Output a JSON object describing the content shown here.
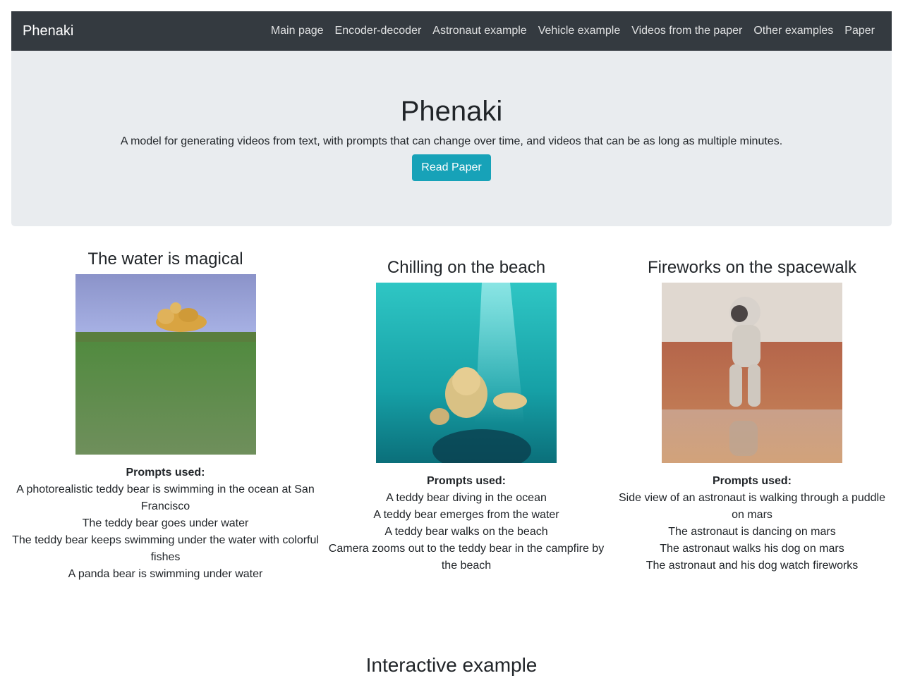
{
  "navbar": {
    "brand": "Phenaki",
    "links": [
      "Main page",
      "Encoder-decoder",
      "Astronaut example",
      "Vehicle example",
      "Videos from the paper",
      "Other examples",
      "Paper"
    ]
  },
  "hero": {
    "title": "Phenaki",
    "subtitle": "A model for generating videos from text, with prompts that can change over time, and videos that can be as long as multiple minutes.",
    "button": "Read Paper"
  },
  "examples": [
    {
      "title": "The water is magical",
      "prompts_label": "Prompts used:",
      "prompts": [
        "A photorealistic teddy bear is swimming in the ocean at San Francisco",
        "The teddy bear goes under water",
        "The teddy bear keeps swimming under the water with colorful fishes",
        "A panda bear is swimming under water"
      ]
    },
    {
      "title": "Chilling on the beach",
      "prompts_label": "Prompts used:",
      "prompts": [
        "A teddy bear diving in the ocean",
        "A teddy bear emerges from the water",
        "A teddy bear walks on the beach",
        "Camera zooms out to the teddy bear in the campfire by the beach"
      ]
    },
    {
      "title": "Fireworks on the spacewalk",
      "prompts_label": "Prompts used:",
      "prompts": [
        "Side view of an astronaut is walking through a puddle on mars",
        "The astronaut is dancing on mars",
        "The astronaut walks his dog on mars",
        "The astronaut and his dog watch fireworks"
      ]
    }
  ],
  "section_title": "Interactive example",
  "colors": {
    "navbar": "#343a40",
    "hero": "#e9ecef",
    "button": "#17a2b8"
  }
}
